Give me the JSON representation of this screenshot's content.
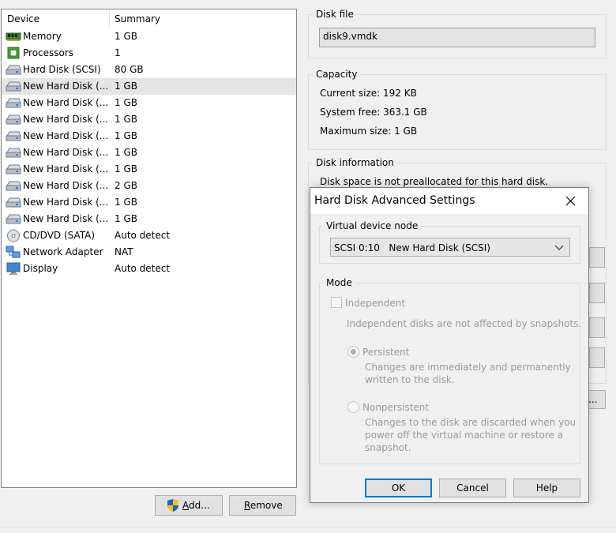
{
  "device_list": {
    "headers": {
      "device": "Device",
      "summary": "Summary"
    },
    "rows": [
      {
        "icon": "memory-icon",
        "name": "Memory",
        "summary": "1 GB"
      },
      {
        "icon": "processor-icon",
        "name": "Processors",
        "summary": "1"
      },
      {
        "icon": "hard-disk-icon",
        "name": "Hard Disk (SCSI)",
        "summary": "80 GB"
      },
      {
        "icon": "hard-disk-icon",
        "name": "New Hard Disk (...",
        "summary": "1 GB"
      },
      {
        "icon": "hard-disk-icon",
        "name": "New Hard Disk (...",
        "summary": "1 GB"
      },
      {
        "icon": "hard-disk-icon",
        "name": "New Hard Disk (...",
        "summary": "1 GB"
      },
      {
        "icon": "hard-disk-icon",
        "name": "New Hard Disk (...",
        "summary": "1 GB"
      },
      {
        "icon": "hard-disk-icon",
        "name": "New Hard Disk (...",
        "summary": "1 GB"
      },
      {
        "icon": "hard-disk-icon",
        "name": "New Hard Disk (...",
        "summary": "1 GB"
      },
      {
        "icon": "hard-disk-icon",
        "name": "New Hard Disk (...",
        "summary": "2 GB"
      },
      {
        "icon": "hard-disk-icon",
        "name": "New Hard Disk (...",
        "summary": "1 GB"
      },
      {
        "icon": "hard-disk-icon",
        "name": "New Hard Disk (...",
        "summary": "1 GB"
      },
      {
        "icon": "cd-dvd-icon",
        "name": "CD/DVD (SATA)",
        "summary": "Auto detect"
      },
      {
        "icon": "network-adapter-icon",
        "name": "Network Adapter",
        "summary": "NAT"
      },
      {
        "icon": "display-icon",
        "name": "Display",
        "summary": "Auto detect"
      }
    ],
    "selected_index": 3
  },
  "buttons": {
    "add_label": "Add...",
    "add_mnemonic": "A",
    "add_rest": "dd...",
    "remove_mnemonic": "R",
    "remove_rest": "emove"
  },
  "disk_file": {
    "title": "Disk file",
    "value": "disk9.vmdk"
  },
  "capacity": {
    "title": "Capacity",
    "current_size": "Current size: 192 KB",
    "system_free": "System free: 363.1 GB",
    "maximum_size": "Maximum size: 1 GB"
  },
  "disk_information": {
    "title": "Disk information",
    "line1": "Disk space is not preallocated for this hard disk."
  },
  "hidden_button_label": "...",
  "dialog": {
    "title": "Hard Disk Advanced Settings",
    "virtual_device_node": {
      "title": "Virtual device node",
      "selected": "SCSI 0:10   New Hard Disk (SCSI)"
    },
    "mode": {
      "title": "Mode",
      "independent_label": "Independent",
      "independent_checked": false,
      "independent_desc": "Independent disks are not affected by snapshots.",
      "persistent_label": "Persistent",
      "persistent_selected": true,
      "persistent_desc_1": "Changes are immediately and permanently",
      "persistent_desc_2": "written to the disk.",
      "nonpersistent_label": "Nonpersistent",
      "nonpersistent_selected": false,
      "nonpersistent_desc_1": "Changes to the disk are discarded when you",
      "nonpersistent_desc_2": "power off the virtual machine or restore a",
      "nonpersistent_desc_3": "snapshot."
    },
    "ok_label": "OK",
    "cancel_label": "Cancel",
    "help_label": "Help"
  },
  "colors": {
    "accent": "#0078d7",
    "selected_row": "#e5e5e5",
    "disabled_text": "#9a9a9a",
    "uac_shield_blue": "#1f5fbf",
    "uac_shield_yellow": "#f6c31c"
  }
}
